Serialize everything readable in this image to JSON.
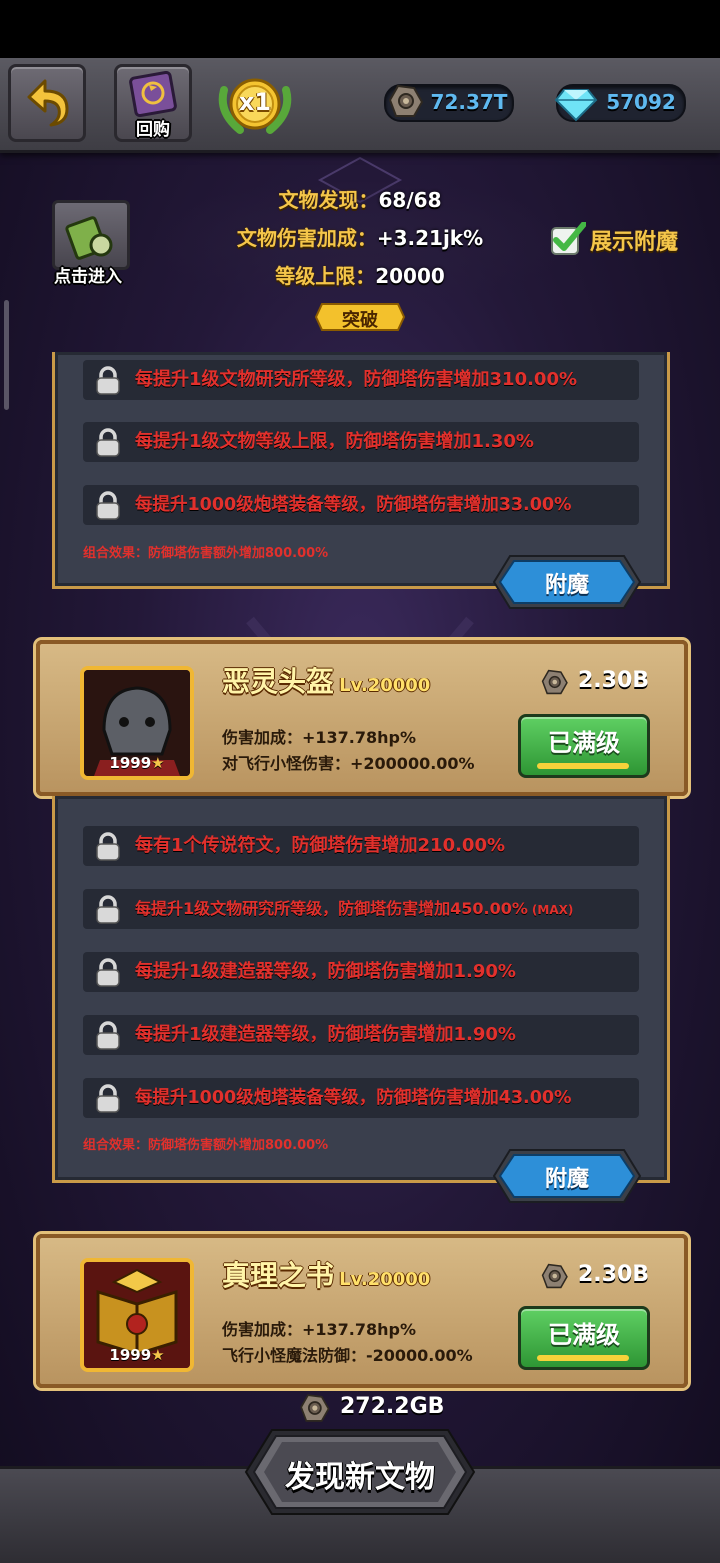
{
  "topbar": {
    "back_icon": "undo-arrow-icon",
    "buyback_label": "回购",
    "speed_label": "x1",
    "stone_amount": "72.37T",
    "gem_amount": "57092"
  },
  "header": {
    "enter_label": "点击进入",
    "found_label": "文物发现：",
    "found_value": "68/68",
    "damage_label": "文物伤害加成：",
    "damage_value": "+3.21jk%",
    "level_cap_label": "等级上限：",
    "level_cap_value": "20000",
    "breakthrough_label": "突破",
    "show_enchant_label": "展示附魔",
    "show_enchant_checked": true
  },
  "panel1": {
    "rows": [
      "每提升1级文物研究所等级，防御塔伤害增加310.00%",
      "每提升1级文物等级上限，防御塔伤害增加1.30%",
      "每提升1000级炮塔装备等级，防御塔伤害增加33.00%"
    ],
    "combo": "组合效果：防御塔伤害额外增加800.00%",
    "enchant_label": "附魔"
  },
  "item1": {
    "name": "恶灵头盔",
    "level": "Lv.20000",
    "stars": "1999",
    "cost": "2.30B",
    "stat1": "伤害加成：+137.78hp%",
    "stat2": "对飞行小怪伤害：+200000.00%",
    "button_label": "已满级"
  },
  "panel2": {
    "rows": [
      "每有1个传说符文，防御塔伤害增加210.00%",
      "每提升1级文物研究所等级，防御塔伤害增加450.00%",
      "每提升1级建造器等级，防御塔伤害增加1.90%",
      "每提升1级建造器等级，防御塔伤害增加1.90%",
      "每提升1000级炮塔装备等级，防御塔伤害增加43.00%"
    ],
    "max_tag": "(MAX)",
    "combo": "组合效果：防御塔伤害额外增加800.00%",
    "enchant_label": "附魔"
  },
  "item2": {
    "name": "真理之书",
    "level": "Lv.20000",
    "stars": "1999",
    "cost": "2.30B",
    "stat1": "伤害加成：+137.78hp%",
    "stat2": "飞行小怪魔法防御：-20000.00%",
    "button_label": "已满级"
  },
  "footer": {
    "discover_cost": "272.2GB",
    "discover_label": "发现新文物"
  },
  "colors": {
    "gold": "#f5c64a",
    "bonus_red": "#e2302c",
    "card_border": "#c99a48",
    "pill_text": "#5fb9f0"
  }
}
